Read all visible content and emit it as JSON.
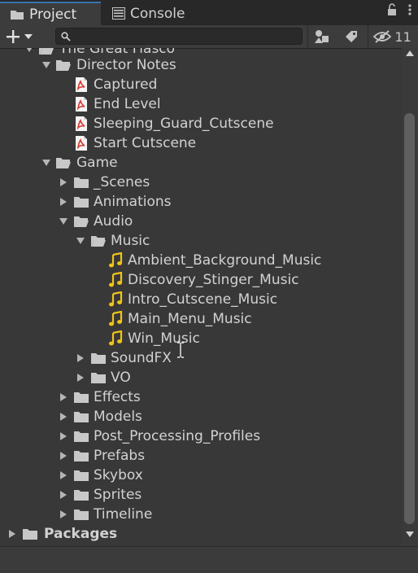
{
  "tabs": {
    "project_label": "Project",
    "console_label": "Console"
  },
  "toolbar": {
    "search_value": "",
    "hidden_count": "11"
  },
  "tree": {
    "root_label": "The Great Fiasco",
    "director_notes": {
      "label": "Director Notes",
      "files": [
        "Captured",
        "End Level",
        "Sleeping_Guard_Cutscene",
        "Start Cutscene"
      ]
    },
    "game": {
      "label": "Game",
      "scenes": "_Scenes",
      "animations": "Animations",
      "audio": "Audio",
      "music": "Music",
      "music_files": [
        "Ambient_Background_Music",
        "Discovery_Stinger_Music",
        "Intro_Cutscene_Music",
        "Main_Menu_Music",
        "Win_Music"
      ],
      "soundfx": "SoundFX",
      "vo": "VO",
      "folders": [
        "Effects",
        "Models",
        "Post_Processing_Profiles",
        "Prefabs",
        "Skybox",
        "Sprites",
        "Timeline"
      ]
    },
    "packages": "Packages"
  },
  "colors": {
    "accent": "#3a72b0",
    "pdf_red": "#d33b32",
    "music_yellow": "#f0c418",
    "folder": "#c8c8c8"
  },
  "icons": {
    "folder": "folder-icon",
    "folder_open": "folder-open-icon",
    "pdf": "pdf-file-icon",
    "music": "music-note-icon"
  }
}
